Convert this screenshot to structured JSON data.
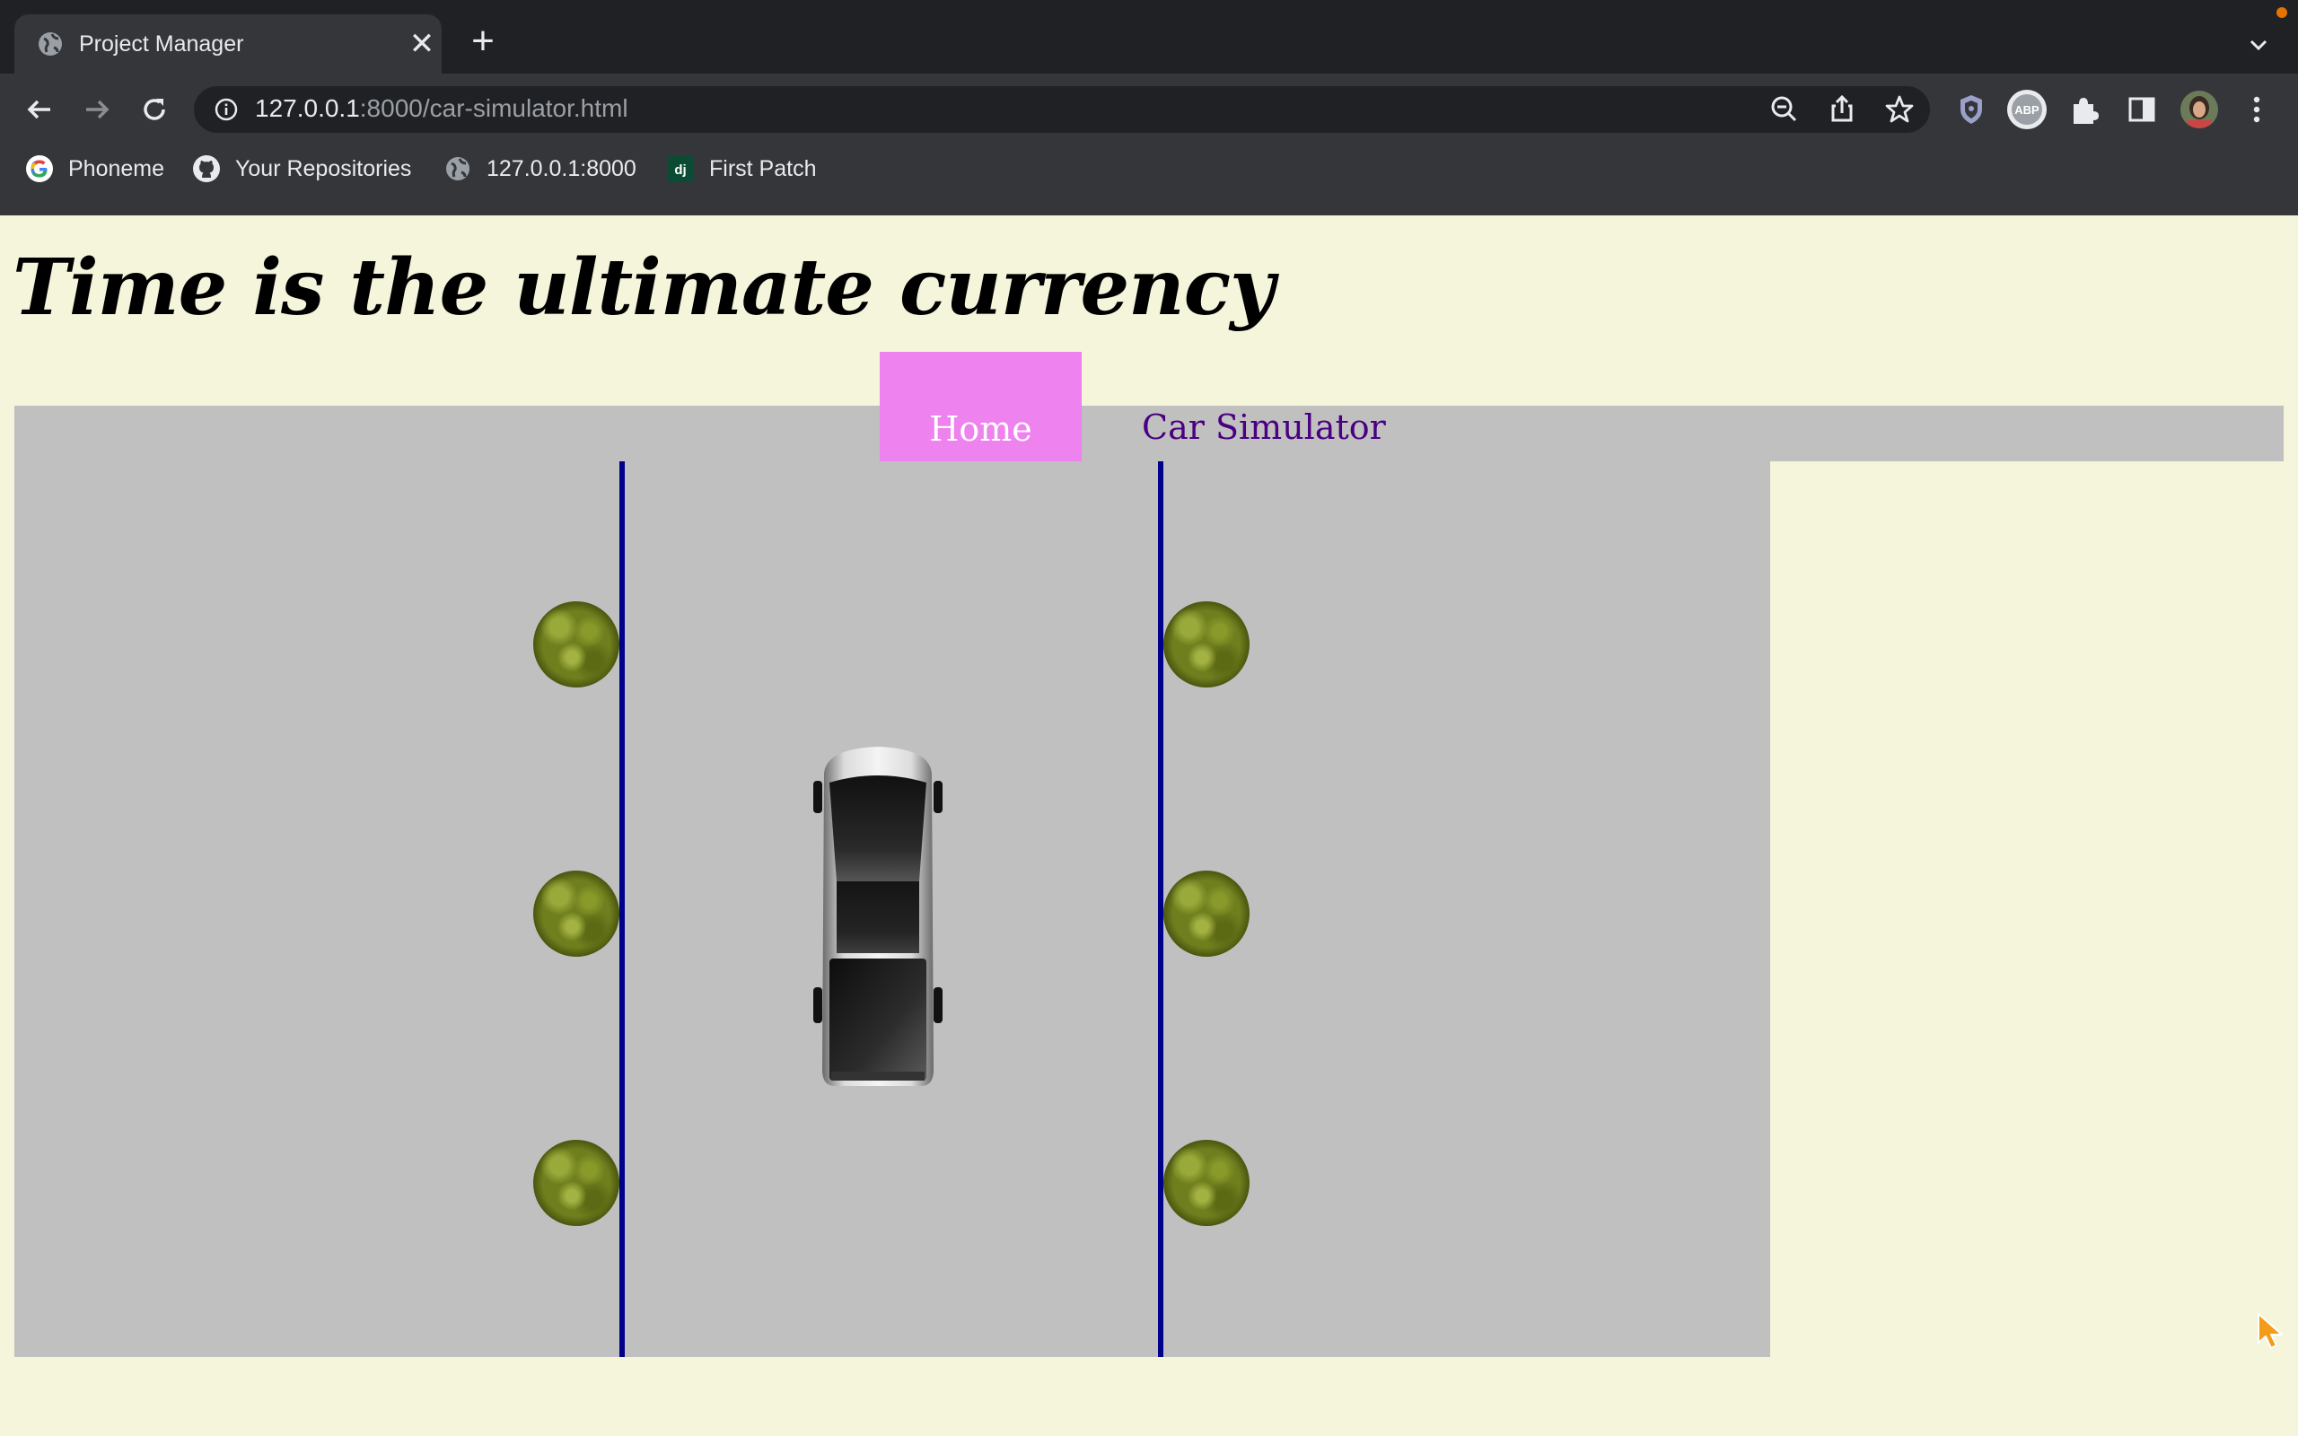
{
  "browser": {
    "tab_title": "Project Manager",
    "tab_close_glyph": "✕",
    "new_tab_glyph": "+",
    "url_host": "127.0.0.1",
    "url_rest": ":8000/car-simulator.html",
    "bookmarks": [
      {
        "label": "Phoneme",
        "icon": "google-icon"
      },
      {
        "label": "Your Repositories",
        "icon": "github-icon"
      },
      {
        "label": "127.0.0.1:8000",
        "icon": "globe-icon"
      },
      {
        "label": "First Patch",
        "icon": "django-icon"
      }
    ],
    "django_badge": "dj",
    "abp_badge": "ABP"
  },
  "page": {
    "heading": "Time is the ultimate currency",
    "nav": {
      "home": "Home",
      "car_simulator": "Car Simulator"
    }
  },
  "colors": {
    "page_bg": "#f5f5dc",
    "road": "#c0c0c0",
    "lane_line": "#00008b",
    "home_bg": "#ee82ee",
    "nav_link": "#4b0082"
  }
}
